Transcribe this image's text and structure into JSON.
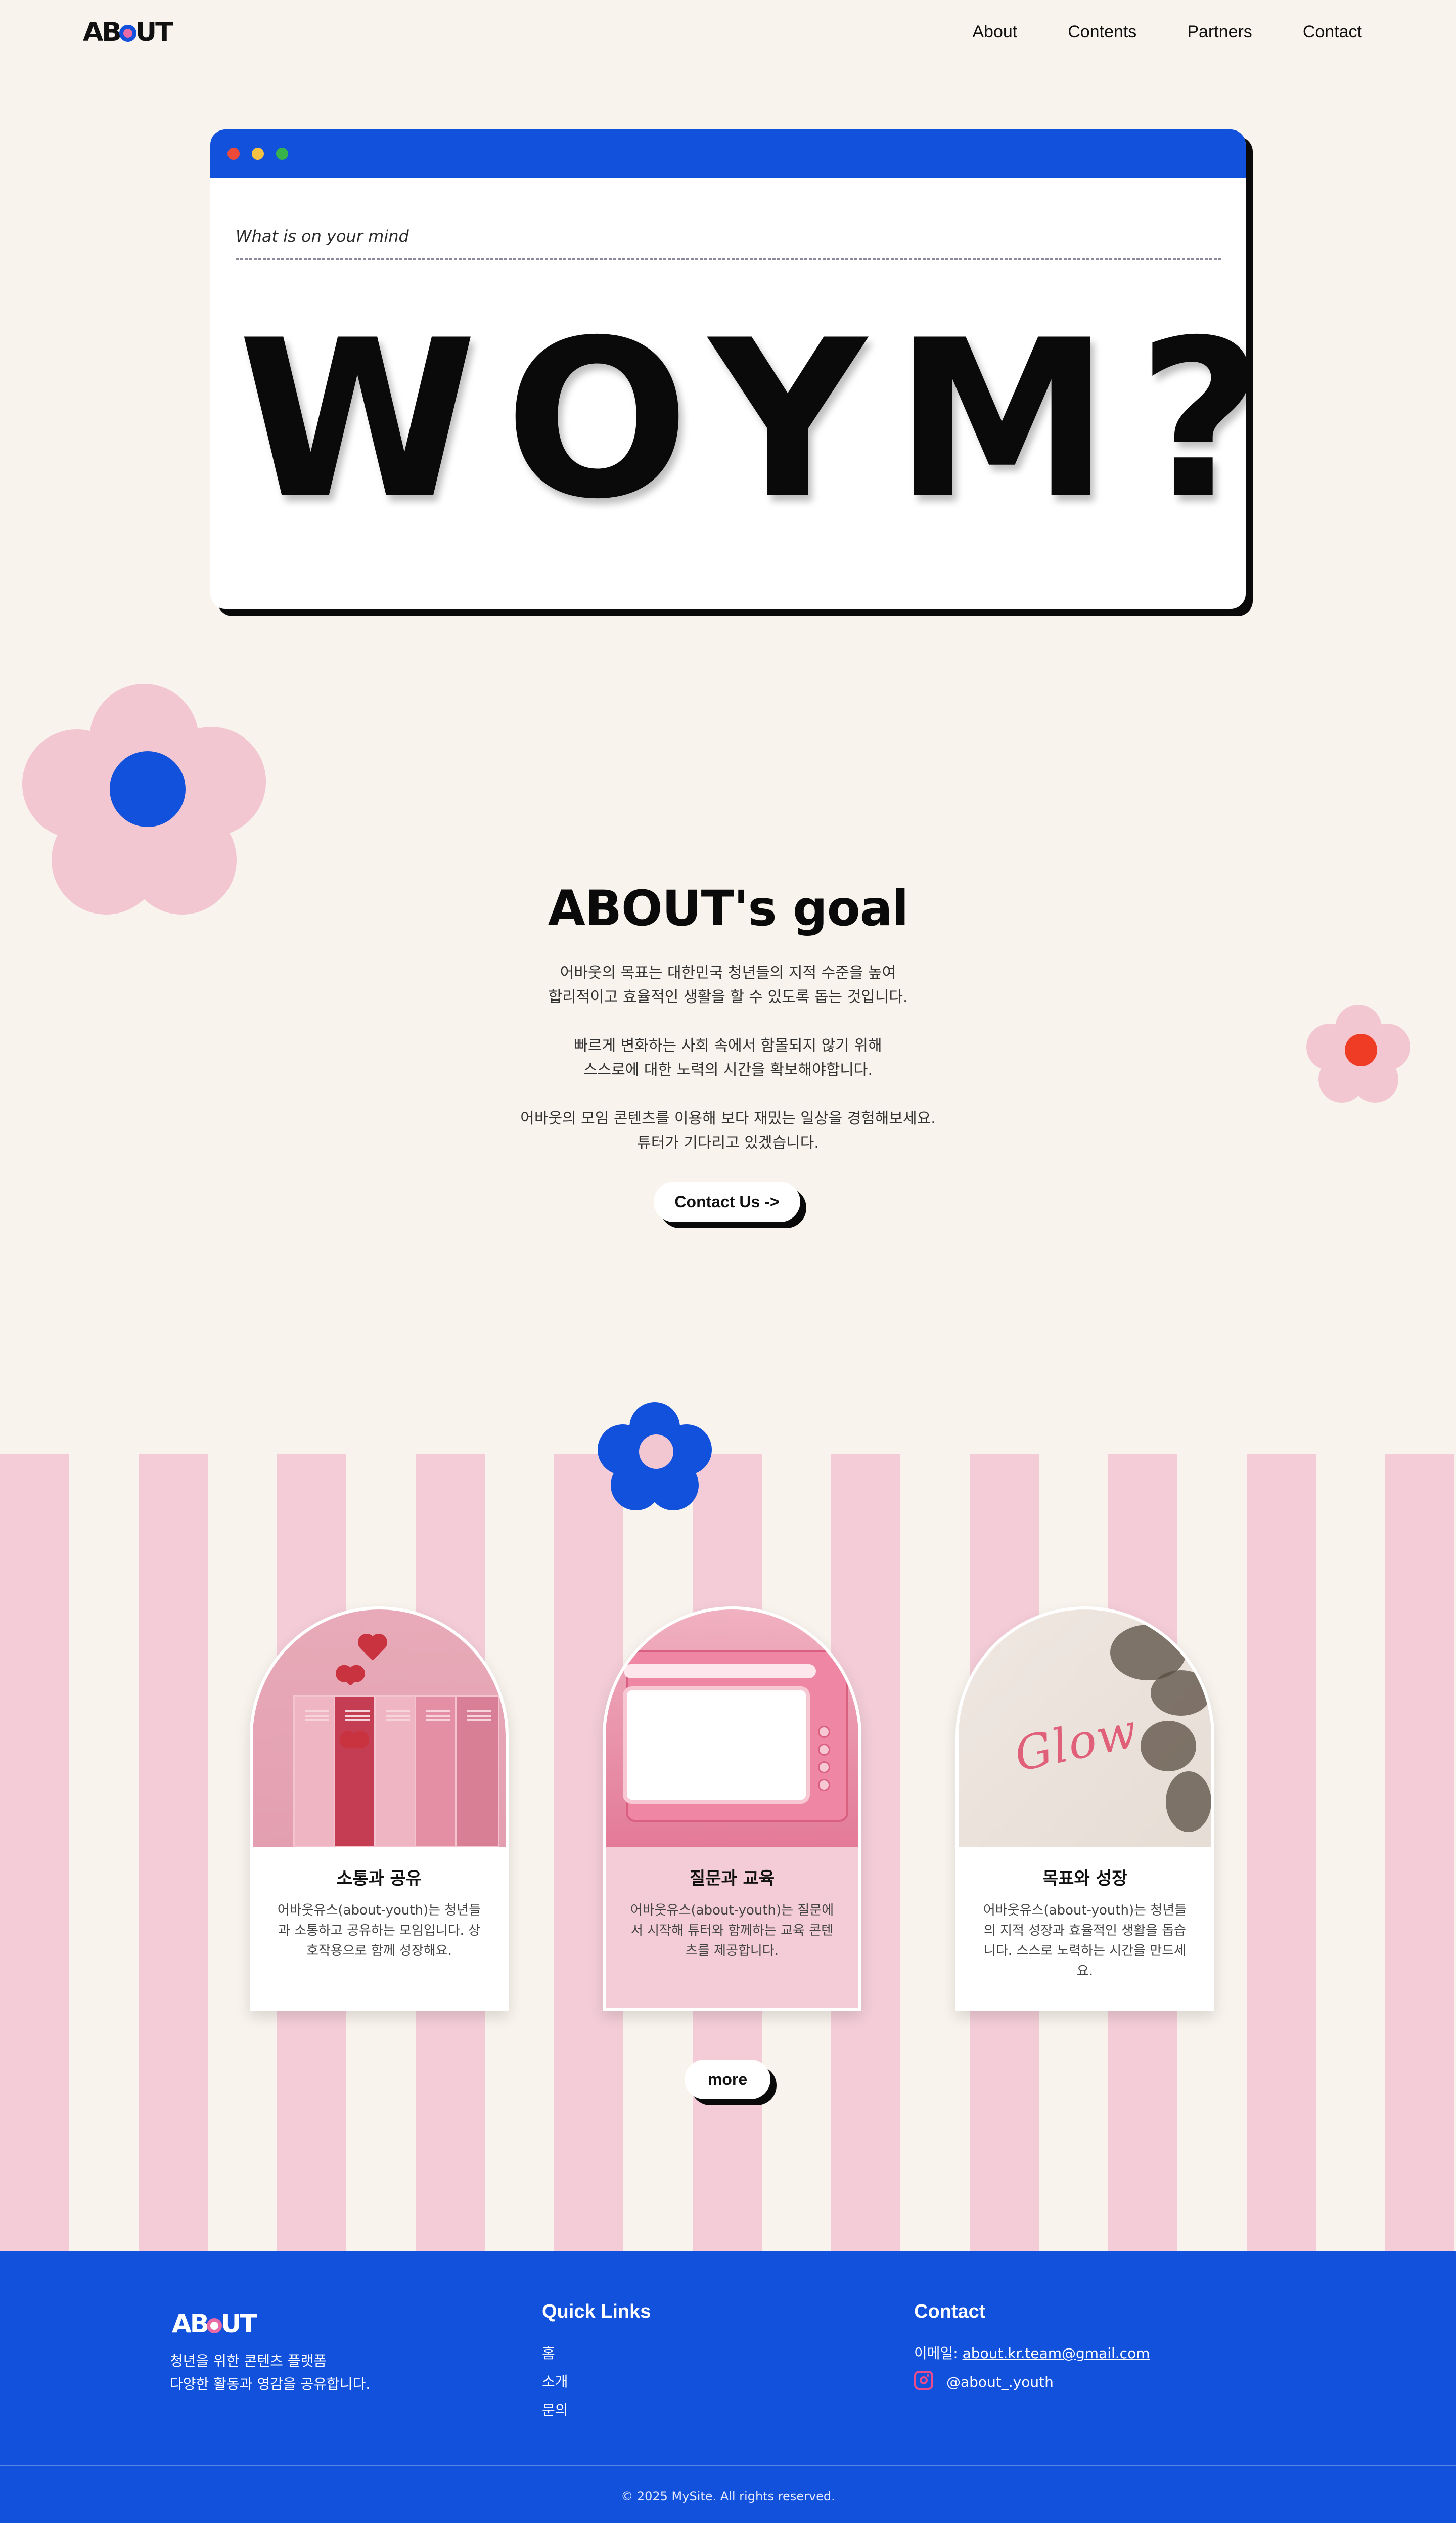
{
  "nav": {
    "logo": "ABOUT",
    "links": [
      "About",
      "Contents",
      "Partners",
      "Contact"
    ]
  },
  "hero": {
    "prompt": "What is on your mind",
    "headline": "WOYM?"
  },
  "goal": {
    "title": "ABOUT's goal",
    "lines": [
      "어바웃의 목표는 대한민국 청년들의 지적 수준을 높여",
      "합리적이고 효율적인 생활을 할 수 있도록 돕는 것입니다.",
      "빠르게 변화하는 사회 속에서 함몰되지 않기 위해",
      "스스로에 대한 노력의 시간을 확보해야합니다.",
      "어바웃의 모임 콘텐츠를 이용해 보다 재밌는 일상을 경험해보세요.",
      "튜터가 기다리고 있겠습니다."
    ],
    "button": "Contact Us ->"
  },
  "cards": [
    {
      "title": "소통과 공유",
      "desc": "어바웃유스(about-youth)는 청년들과 소통하고 공유하는 모임입니다. 상호작용으로 함께 성장해요."
    },
    {
      "title": "질문과 교육",
      "desc": "어바웃유스(about-youth)는 질문에서 시작해 튜터와 함께하는 교육 콘텐츠를 제공합니다."
    },
    {
      "title": "목표와 성장",
      "desc": "어바웃유스(about-youth)는 청년들의 지적 성장과 효율적인 생활을 돕습니다. 스스로 노력하는 시간을 만드세요."
    }
  ],
  "card_image_text": "Glow",
  "more_button": "more",
  "footer": {
    "logo": "ABOUT",
    "desc1": "청년을 위한 콘텐츠 플랫폼",
    "desc2": "다양한 활동과 영감을 공유합니다.",
    "quick_title": "Quick Links",
    "quick_links": [
      "홈",
      "소개",
      "문의"
    ],
    "contact_title": "Contact",
    "email_label": "이메일:",
    "email": "about.kr.team@gmail.com",
    "instagram": "@about_.youth",
    "copyright": "© 2025 MySite. All rights reserved."
  },
  "colors": {
    "background": "#f8f3ec",
    "blue": "#1151db",
    "pink": "#f3ccd7",
    "flower_pink": "#f3c7d2",
    "red_accent": "#ee3d24"
  }
}
